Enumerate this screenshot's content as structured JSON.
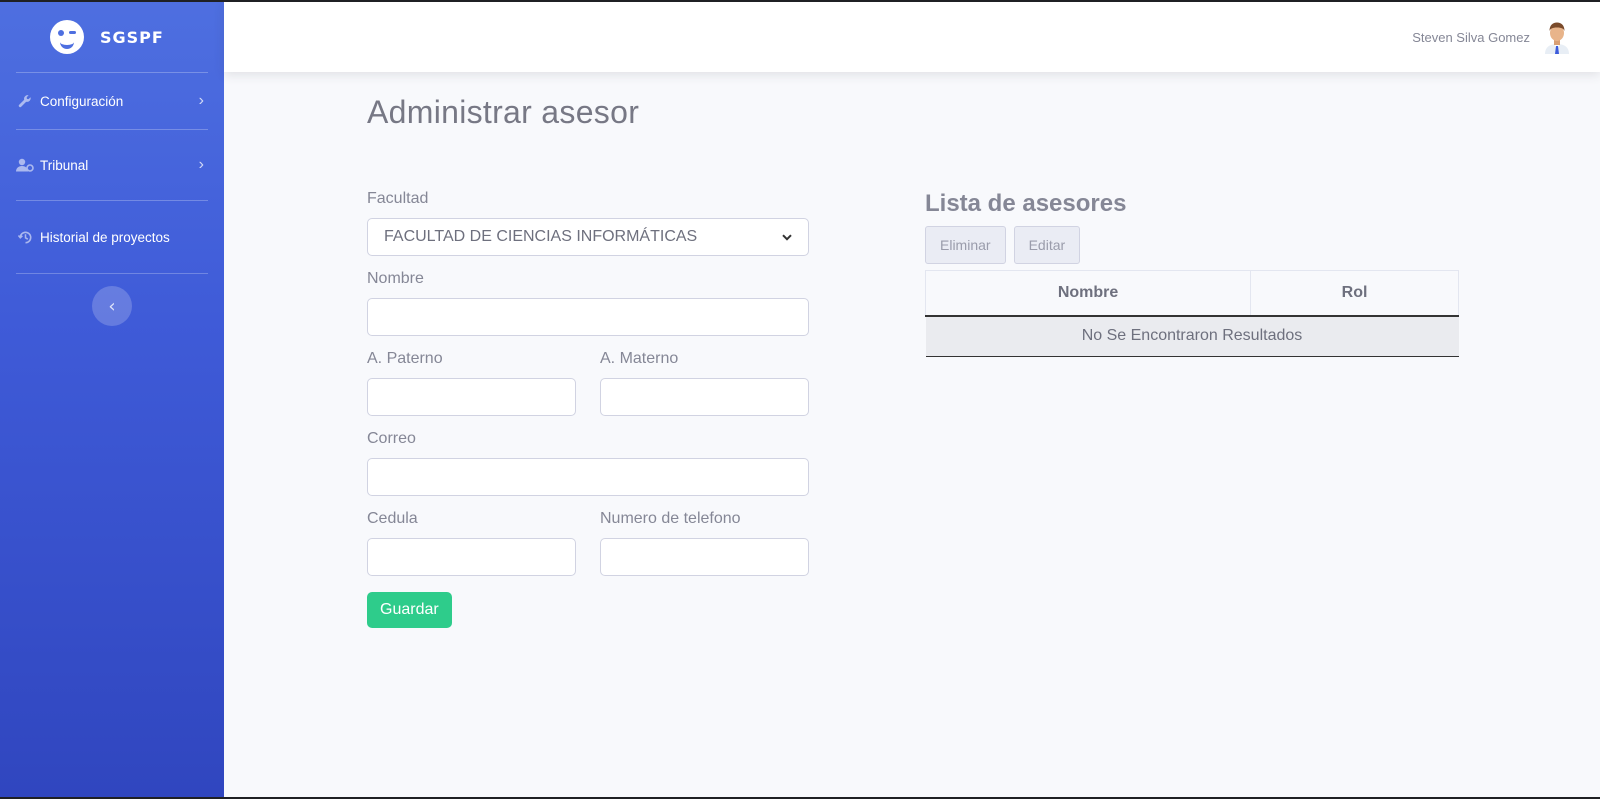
{
  "app": {
    "title": "SGSPF"
  },
  "sidebar": {
    "items": [
      {
        "label": "Configuración",
        "icon": "wrench-icon",
        "has_chevron": true
      },
      {
        "label": "Tribunal",
        "icon": "user-cog-icon",
        "has_chevron": true
      },
      {
        "label": "Historial de proyectos",
        "icon": "history-icon",
        "has_chevron": false
      }
    ],
    "toggle_icon": "chevron-left-icon"
  },
  "topbar": {
    "user_name": "Steven Silva Gomez"
  },
  "page": {
    "title": "Administrar asesor"
  },
  "form": {
    "facultad_label": "Facultad",
    "facultad_value": "FACULTAD DE CIENCIAS INFORMÁTICAS",
    "nombre_label": "Nombre",
    "nombre_value": "",
    "paterno_label": "A. Paterno",
    "paterno_value": "",
    "materno_label": "A. Materno",
    "materno_value": "",
    "correo_label": "Correo",
    "correo_value": "",
    "cedula_label": "Cedula",
    "cedula_value": "",
    "telefono_label": "Numero de telefono",
    "telefono_value": "",
    "save_label": "Guardar"
  },
  "list": {
    "title": "Lista de asesores",
    "delete_label": "Eliminar",
    "edit_label": "Editar",
    "columns": [
      "Nombre",
      "Rol"
    ],
    "empty_text": "No Se Encontraron Resultados"
  },
  "colors": {
    "sidebar_top": "#4e6fe0",
    "sidebar_bottom": "#3046bf",
    "save_button": "#2ecc8b",
    "page_bg": "#f8f9fc"
  }
}
